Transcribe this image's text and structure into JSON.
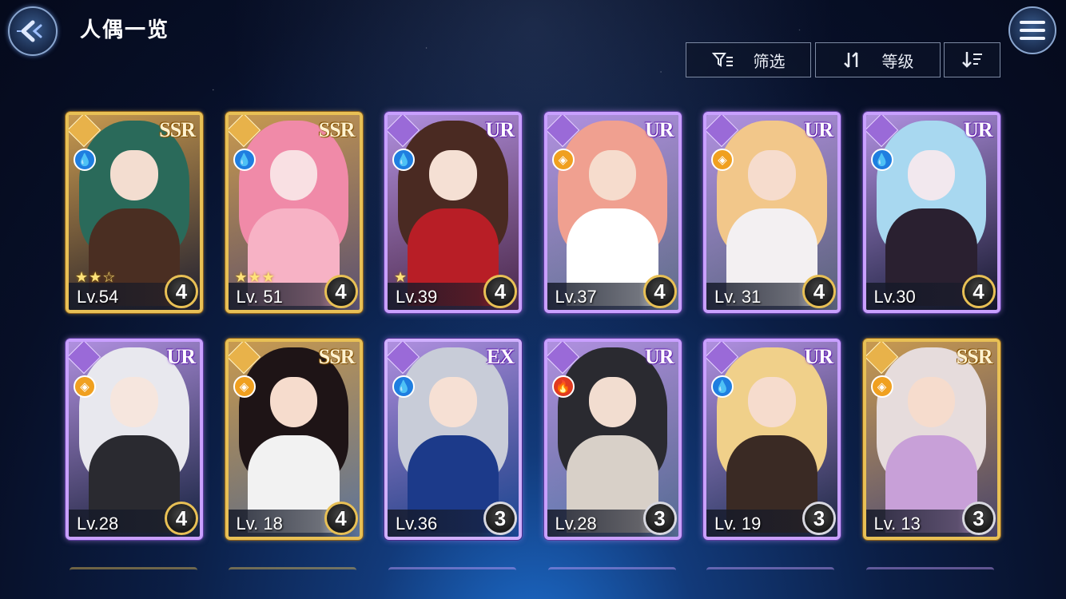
{
  "header": {
    "title": "人偶一览",
    "back_icon": "back-arrow-icon",
    "menu_icon": "hamburger-menu-icon"
  },
  "toolbar": {
    "filter_label": "筛选",
    "sort_label": "等级",
    "order_icon": "sort-descending-icon"
  },
  "cards": [
    {
      "rarity": "SSR",
      "level": "Lv.54",
      "stars": "★★☆",
      "badge": "4",
      "element": "water",
      "faction": "gold",
      "palette": [
        "#2a6a5a",
        "#4a2e22",
        "#f3ddd0"
      ]
    },
    {
      "rarity": "SSR",
      "level": "Lv. 51",
      "stars": "★★★",
      "badge": "4",
      "element": "water",
      "faction": "gold",
      "palette": [
        "#f08aa8",
        "#f7b2c5",
        "#f9e0e3"
      ]
    },
    {
      "rarity": "UR",
      "level": "Lv.39",
      "stars": "★",
      "badge": "4",
      "element": "water",
      "faction": "purple",
      "palette": [
        "#4a2a22",
        "#b81e26",
        "#f5e0d4"
      ]
    },
    {
      "rarity": "UR",
      "level": "Lv.37",
      "stars": "",
      "badge": "4",
      "element": "light",
      "faction": "purple",
      "palette": [
        "#f0a090",
        "#ffffff",
        "#f6dccd"
      ]
    },
    {
      "rarity": "UR",
      "level": "Lv. 31",
      "stars": "",
      "badge": "4",
      "element": "light",
      "faction": "purple",
      "palette": [
        "#f2c78a",
        "#f3f0f2",
        "#f6dccd"
      ]
    },
    {
      "rarity": "UR",
      "level": "Lv.30",
      "stars": "",
      "badge": "4",
      "element": "water",
      "faction": "purple",
      "palette": [
        "#a8d8f0",
        "#2a2030",
        "#f2e8ee"
      ]
    },
    {
      "rarity": "UR",
      "level": "Lv.28",
      "stars": "",
      "badge": "4",
      "element": "light",
      "faction": "purple",
      "palette": [
        "#e8e8ee",
        "#2a2a30",
        "#f6e6de"
      ]
    },
    {
      "rarity": "SSR",
      "level": "Lv. 18",
      "stars": "",
      "badge": "4",
      "element": "light",
      "faction": "gold",
      "palette": [
        "#1e1416",
        "#f2f2f2",
        "#f6dccd"
      ]
    },
    {
      "rarity": "EX",
      "level": "Lv.36",
      "stars": "",
      "badge": "3",
      "element": "water",
      "faction": "purple",
      "palette": [
        "#c8ccd8",
        "#1c3a8a",
        "#f6e0d4"
      ]
    },
    {
      "rarity": "UR",
      "level": "Lv.28",
      "stars": "",
      "badge": "3",
      "element": "fire",
      "faction": "purple",
      "palette": [
        "#2a2a30",
        "#d8d0c8",
        "#f2ddd0"
      ]
    },
    {
      "rarity": "UR",
      "level": "Lv. 19",
      "stars": "",
      "badge": "3",
      "element": "water",
      "faction": "purple",
      "palette": [
        "#f0d08a",
        "#3a2a24",
        "#f6dccd"
      ]
    },
    {
      "rarity": "SSR",
      "level": "Lv. 13",
      "stars": "",
      "badge": "3",
      "element": "light",
      "faction": "gold",
      "palette": [
        "#e6dcdc",
        "#c8a0d8",
        "#f6dccd"
      ]
    }
  ]
}
